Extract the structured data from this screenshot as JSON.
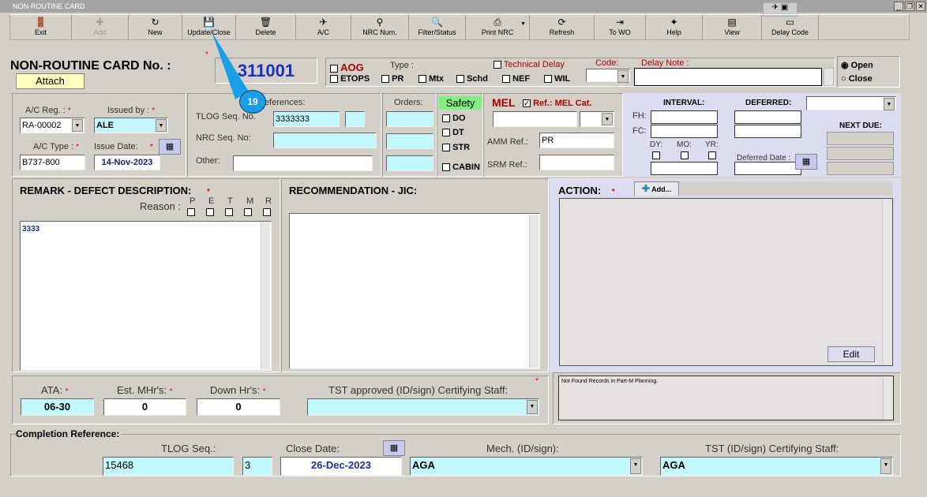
{
  "window": {
    "title": "NON-ROUTINE CARD"
  },
  "toolbar": [
    {
      "label": "Exit",
      "icon": "exit-door-icon"
    },
    {
      "label": "Add",
      "icon": "plus-icon"
    },
    {
      "label": "New",
      "icon": "new-arrow-icon"
    },
    {
      "label": "Update/Close",
      "icon": "floppy-save-icon"
    },
    {
      "label": "Delete",
      "icon": "trash-icon"
    },
    {
      "label": "A/C",
      "icon": "aircraft-icon"
    },
    {
      "label": "NRC Num.",
      "icon": "magnifier-color-icon"
    },
    {
      "label": "Filter/Status",
      "icon": "search-icon"
    },
    {
      "label": "Print NRC",
      "icon": "printer-icon"
    },
    {
      "label": "Refresh",
      "icon": "refresh-icon"
    },
    {
      "label": "To WO",
      "icon": "to-wo-icon"
    },
    {
      "label": "Help",
      "icon": "help-book-icon"
    },
    {
      "label": "View",
      "icon": "view-icon"
    },
    {
      "label": "Delay Code",
      "icon": "delay-code-icon"
    }
  ],
  "header": {
    "title": "NON-ROUTINE CARD No. :",
    "attach": "Attach",
    "card_number": "311001",
    "aog": "AOG",
    "type_label": "Type :",
    "etops": "ETOPS",
    "pr": "PR",
    "mtx": "Mtx",
    "schd": "Schd",
    "nef": "NEF",
    "wil": "WIL",
    "technical_delay": "Technical Delay",
    "code_label": "Code:",
    "delay_note_label": "Delay Note :",
    "open": "Open",
    "close": "Close",
    "status": "Open"
  },
  "aircraft": {
    "ac_reg_label": "A/C Reg. :",
    "ac_reg": "RA-00002",
    "issued_by_label": "Issued by :",
    "issued_by": "ALE",
    "ac_type_label": "A/C Type :",
    "ac_type": "B737-800",
    "issue_date_label": "Issue Date:",
    "issue_date": "14-Nov-2023"
  },
  "references": {
    "title": "References:",
    "tlog_label": "TLOG Seq. No.",
    "tlog": "3333333",
    "nrc_seq_label": "NRC Seq. No:",
    "other_label": "Other:"
  },
  "orders": {
    "label": "Orders:"
  },
  "safety": {
    "label": "Safety",
    "do": "DO",
    "dt": "DT",
    "str": "STR",
    "cabin": "CABIN"
  },
  "mel": {
    "label": "MEL",
    "ref_label": "Ref.: MEL Cat.",
    "ref_checked": true,
    "amm_label": "AMM Ref.:",
    "amm": "PR",
    "srm_label": "SRM Ref.:"
  },
  "interval": {
    "interval_label": "INTERVAL:",
    "deferred_label": "DEFERRED:",
    "fh": "FH:",
    "fc": "FC:",
    "dy": "DY:",
    "mo": "MO:",
    "yr": "YR:",
    "deferred_date_label": "Deferred Date :",
    "next_due_label": "NEXT DUE:"
  },
  "remark": {
    "title": "REMARK - DEFECT DESCRIPTION:",
    "reason_label": "Reason :",
    "reasons": [
      "P",
      "E",
      "T",
      "M",
      "R"
    ],
    "text": "3333"
  },
  "recommendation": {
    "title": "RECOMMENDATION - JIC:"
  },
  "action": {
    "title": "ACTION:",
    "add": "Add...",
    "edit": "Edit"
  },
  "bottom": {
    "ata_label": "ATA:",
    "ata": "06-30",
    "est_label": "Est. MHr's:",
    "est": "0",
    "down_label": "Down Hr's:",
    "down": "0",
    "tst_label": "TST approved (ID/sign) Certifying Staff:",
    "message": "Not Found Records in Part-M Planning."
  },
  "completion": {
    "title": "Completion Reference:",
    "tlog_label": "TLOG Seq.:",
    "tlog": "15468",
    "tlog2": "3",
    "close_date_label": "Close Date:",
    "close_date": "26-Dec-2023",
    "mech_label": "Mech. (ID/sign):",
    "mech": "AGA",
    "tst_label": "TST (ID/sign) Certifying Staff:",
    "tst": "AGA"
  },
  "annotation": {
    "number": "19"
  }
}
